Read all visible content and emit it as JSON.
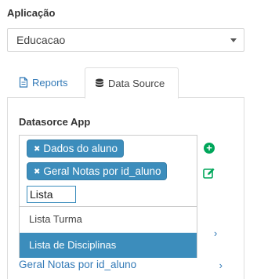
{
  "app": {
    "label": "Aplicação",
    "selected": "Educacao"
  },
  "tabs": [
    {
      "label": "Reports",
      "icon": "file-icon",
      "active": false
    },
    {
      "label": "Data Source",
      "icon": "database-icon",
      "active": true
    }
  ],
  "datasource": {
    "title": "Datasorce App",
    "selected_chips": [
      "Dados do aluno",
      "Geral Notas por id_aluno"
    ],
    "search_value": "Lista",
    "options": [
      {
        "label": "Lista Turma",
        "highlighted": false
      },
      {
        "label": "Lista de Disciplinas",
        "highlighted": true
      }
    ],
    "list_items": [
      {
        "label": "Geral Notas por id_aluno"
      }
    ]
  },
  "colors": {
    "chip": "#3c8dbc",
    "link": "#337ab7",
    "add": "#00a65a"
  }
}
